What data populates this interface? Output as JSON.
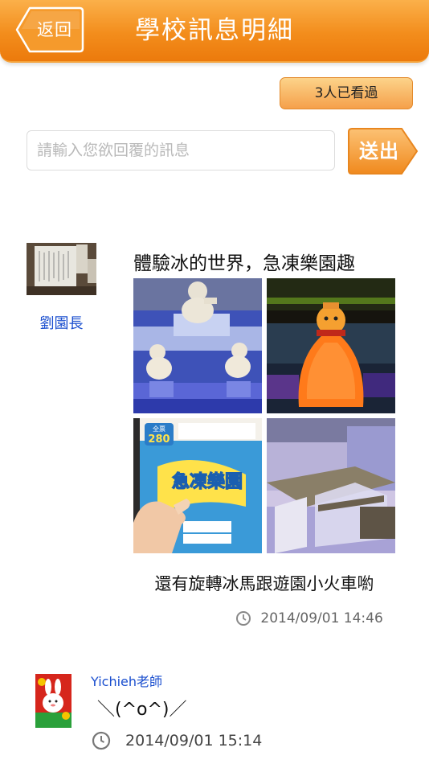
{
  "header": {
    "back_label": "返回",
    "title": "學校訊息明細"
  },
  "viewed": {
    "label": "3人已看過"
  },
  "reply": {
    "placeholder": "請輸入您欲回覆的訊息",
    "send_label": "送出"
  },
  "post": {
    "author": "劉園長",
    "title": "體驗冰的世界，急凍樂園趣",
    "photos": [
      {
        "icon": "snowman-ice-sculpture-photo"
      },
      {
        "icon": "orange-ice-sculpture-photo"
      },
      {
        "icon": "ticket-in-hand-photo"
      },
      {
        "icon": "ice-bench-photo"
      }
    ],
    "ticket": {
      "price": "280",
      "brand": "急凍樂園"
    },
    "caption": "還有旋轉冰馬跟遊園小火車喲",
    "time": "2014/09/01  14:46"
  },
  "comment": {
    "author": "Yichieh老師",
    "text": "＼(^o^)／",
    "time": "2014/09/01  15:14"
  },
  "colors": {
    "header_orange": "#f38d1c",
    "name_blue": "#1b4fcf",
    "button_orange": "#f5a04a"
  }
}
